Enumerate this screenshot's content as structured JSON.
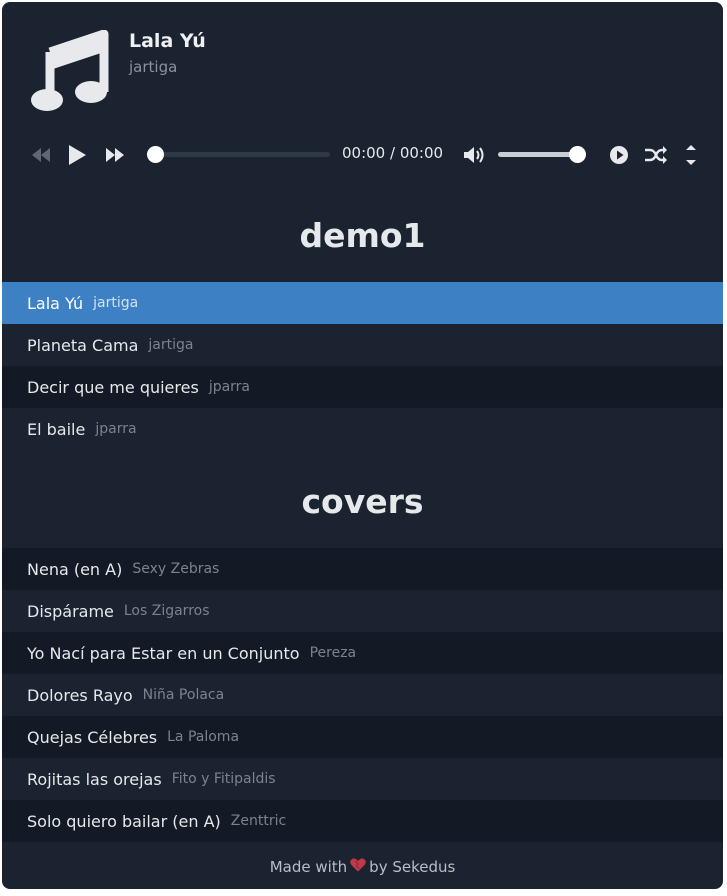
{
  "now_playing": {
    "title": "Lala Yú",
    "artist": "jartiga",
    "cover_icon": "music-note-icon"
  },
  "controls": {
    "icons": [
      "rewind-icon",
      "play-icon",
      "fast-forward-icon",
      "volume-icon",
      "autoplay-icon",
      "shuffle-icon",
      "expand-collapse-icon"
    ],
    "time_display": "00:00 / 00:00",
    "progress": 0,
    "volume": 1.0
  },
  "playlists": [
    {
      "title": "demo1",
      "tracks": [
        {
          "title": "Lala Yú",
          "artist": "jartiga",
          "active": true
        },
        {
          "title": "Planeta Cama",
          "artist": "jartiga"
        },
        {
          "title": "Decir que me quieres",
          "artist": "jparra"
        },
        {
          "title": "El baile",
          "artist": "jparra"
        }
      ]
    },
    {
      "title": "covers",
      "tracks": [
        {
          "title": "Nena (en A)",
          "artist": "Sexy Zebras"
        },
        {
          "title": "Dispárame",
          "artist": "Los Zigarros"
        },
        {
          "title": "Yo Nací para Estar en un Conjunto",
          "artist": "Pereza"
        },
        {
          "title": "Dolores Rayo",
          "artist": "Niña Polaca"
        },
        {
          "title": "Quejas Célebres",
          "artist": "La Paloma"
        },
        {
          "title": "Rojitas las orejas",
          "artist": "Fito y Fitipaldis"
        },
        {
          "title": "Solo quiero bailar (en A)",
          "artist": "Zenttric"
        }
      ]
    }
  ],
  "footer": {
    "prefix": "Made with",
    "heart_icon": "heart-icon",
    "suffix": "by Sekedus"
  },
  "colors": {
    "background": "#1b2330",
    "row_alt": "#131a25",
    "active_row": "#3e80c4",
    "heart": "#c0394b"
  }
}
